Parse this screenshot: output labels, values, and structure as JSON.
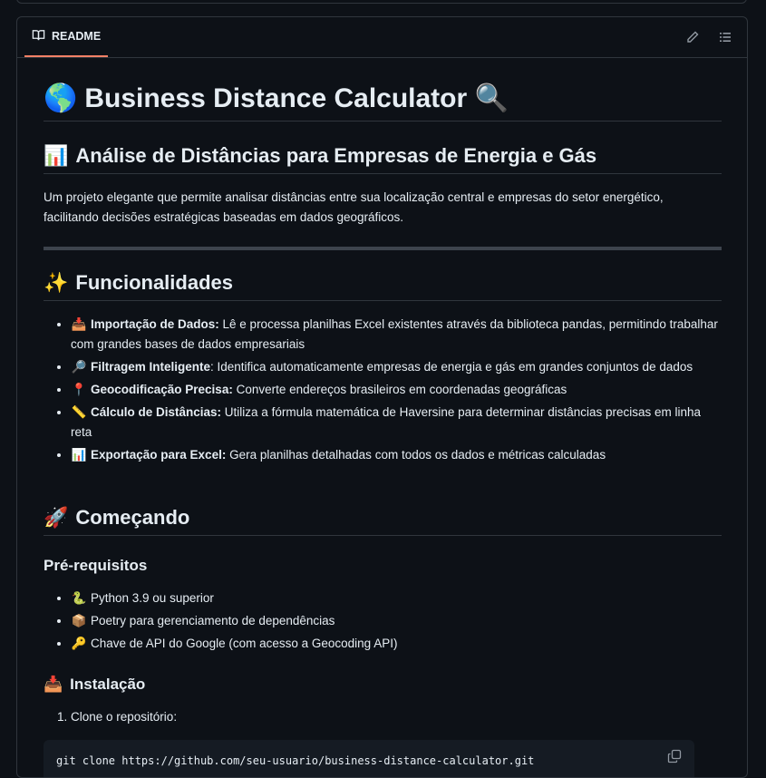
{
  "readme": {
    "tab_label": "README",
    "h1": {
      "emoji": "🌎",
      "text": "Business Distance Calculator",
      "emoji_end": "🔍"
    },
    "h2_analysis": {
      "emoji": "📊",
      "text": "Análise de Distâncias para Empresas de Energia e Gás"
    },
    "intro": "Um projeto elegante que permite analisar distâncias entre sua localização central e empresas do setor energético, facilitando decisões estratégicas baseadas em dados geográficos.",
    "h2_features": {
      "emoji": "✨",
      "text": "Funcionalidades"
    },
    "features": [
      {
        "emoji": "📥",
        "title": "Importação de Dados:",
        "text": " Lê e processa planilhas Excel existentes através da biblioteca pandas, permitindo trabalhar com grandes bases de dados empresariais"
      },
      {
        "emoji": "🔎",
        "title": "Filtragem Inteligente",
        "text": ": Identifica automaticamente empresas de energia e gás em grandes conjuntos de dados"
      },
      {
        "emoji": "📍",
        "title": "Geocodificação Precisa:",
        "text": " Converte endereços brasileiros em coordenadas geográficas"
      },
      {
        "emoji": "📏",
        "title": "Cálculo de Distâncias:",
        "text": " Utiliza a fórmula matemática de Haversine para determinar distâncias precisas em linha reta"
      },
      {
        "emoji": "📊",
        "title": "Exportação para Excel:",
        "text": " Gera planilhas detalhadas com todos os dados e métricas calculadas"
      }
    ],
    "h2_start": {
      "emoji": "🚀",
      "text": "Começando"
    },
    "h3_prereq": "Pré-requisitos",
    "prereqs": [
      {
        "emoji": "🐍",
        "text": "Python 3.9 ou superior"
      },
      {
        "emoji": "📦",
        "text": "Poetry para gerenciamento de dependências"
      },
      {
        "emoji": "🔑",
        "text": "Chave de API do Google (com acesso a Geocoding API)"
      }
    ],
    "h3_install": {
      "emoji": "📥",
      "text": "Instalação"
    },
    "steps": [
      "Clone o repositório:"
    ],
    "code": "git clone https://github.com/seu-usuario/business-distance-calculator.git"
  },
  "icons": {
    "tab": "book-icon",
    "edit": "pencil-icon",
    "outline": "list-icon",
    "copy": "copy-icon"
  }
}
